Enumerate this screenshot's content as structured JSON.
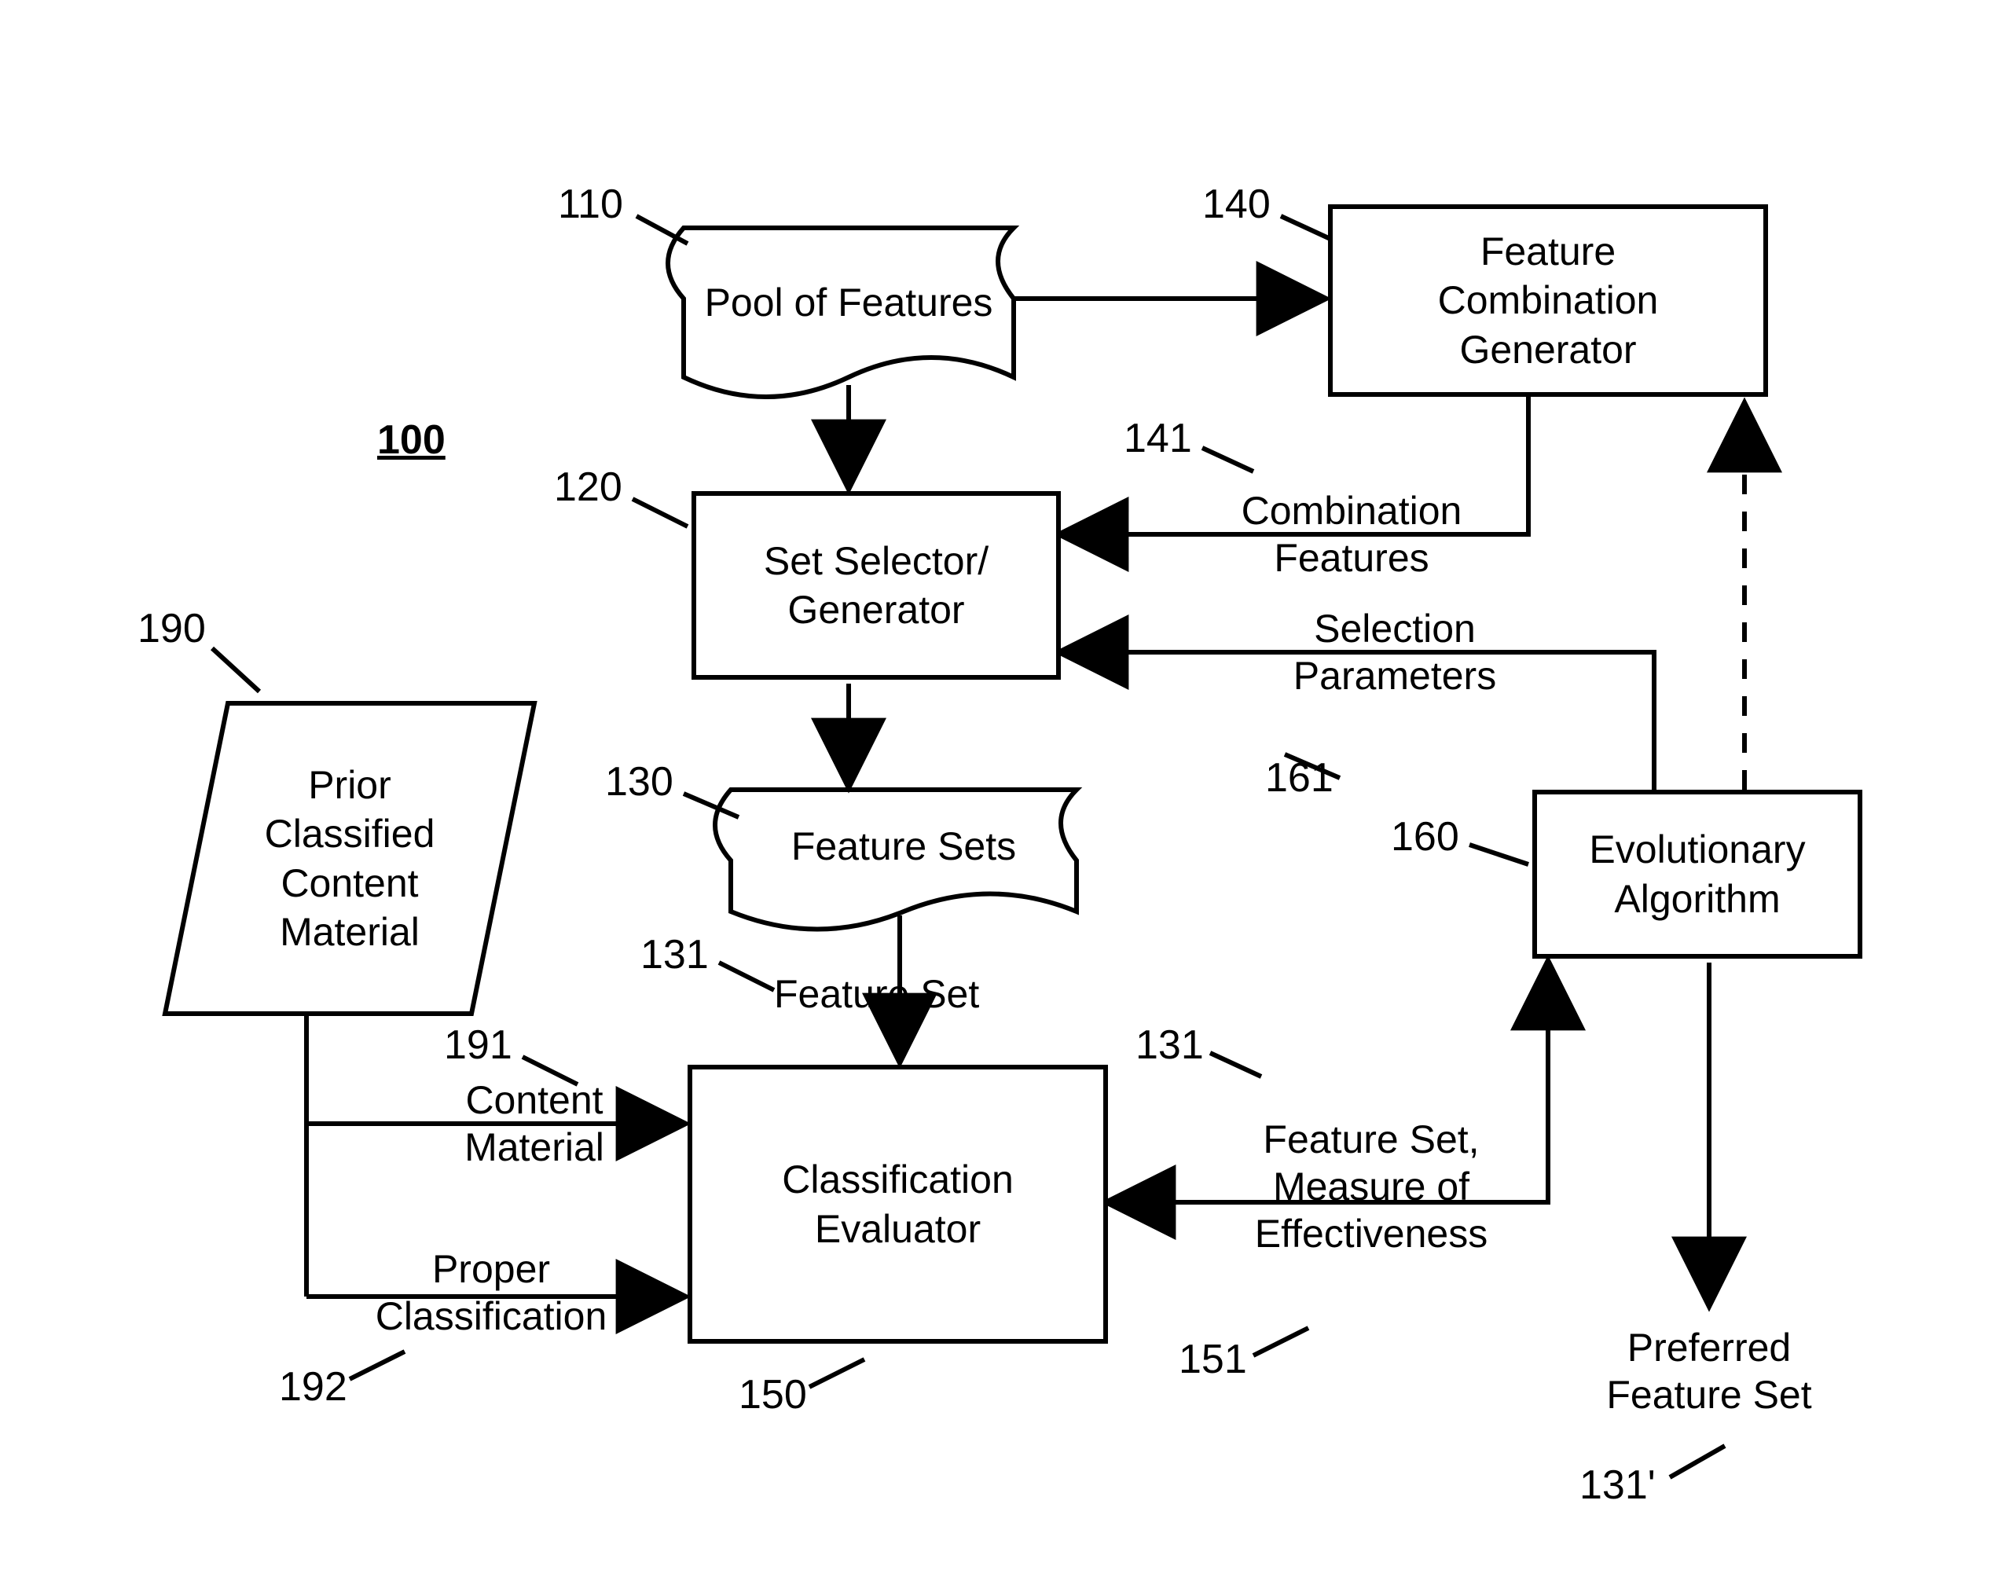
{
  "figure_ref": "100",
  "nodes": {
    "pool": {
      "ref": "110",
      "label": "Pool of Features"
    },
    "fcg": {
      "ref": "140",
      "label": "Feature\nCombination\nGenerator"
    },
    "selector": {
      "ref": "120",
      "label": "Set Selector/\nGenerator"
    },
    "fsets": {
      "ref": "130",
      "label": "Feature Sets"
    },
    "evaluator": {
      "ref": "150",
      "label": "Classification\nEvaluator"
    },
    "evo": {
      "ref": "160",
      "label": "Evolutionary\nAlgorithm"
    },
    "prior": {
      "ref": "190",
      "label": "Prior\nClassified\nContent\nMaterial"
    }
  },
  "edges": {
    "combination_features": {
      "ref": "141",
      "label": "Combination\nFeatures"
    },
    "selection_parameters": {
      "ref": "161",
      "label": "Selection\nParameters"
    },
    "feature_set_edge": {
      "ref": "131",
      "label": "Feature Set"
    },
    "content_material": {
      "ref": "191",
      "label": "Content\nMaterial"
    },
    "proper_classification": {
      "ref": "192",
      "label": "Proper\nClassification"
    },
    "feature_set_measure": {
      "ref_a": "131",
      "ref_b": "151",
      "label": "Feature Set,\nMeasure of\nEffectiveness"
    },
    "preferred_feature_set": {
      "ref": "131'",
      "label": "Preferred\nFeature Set"
    }
  }
}
